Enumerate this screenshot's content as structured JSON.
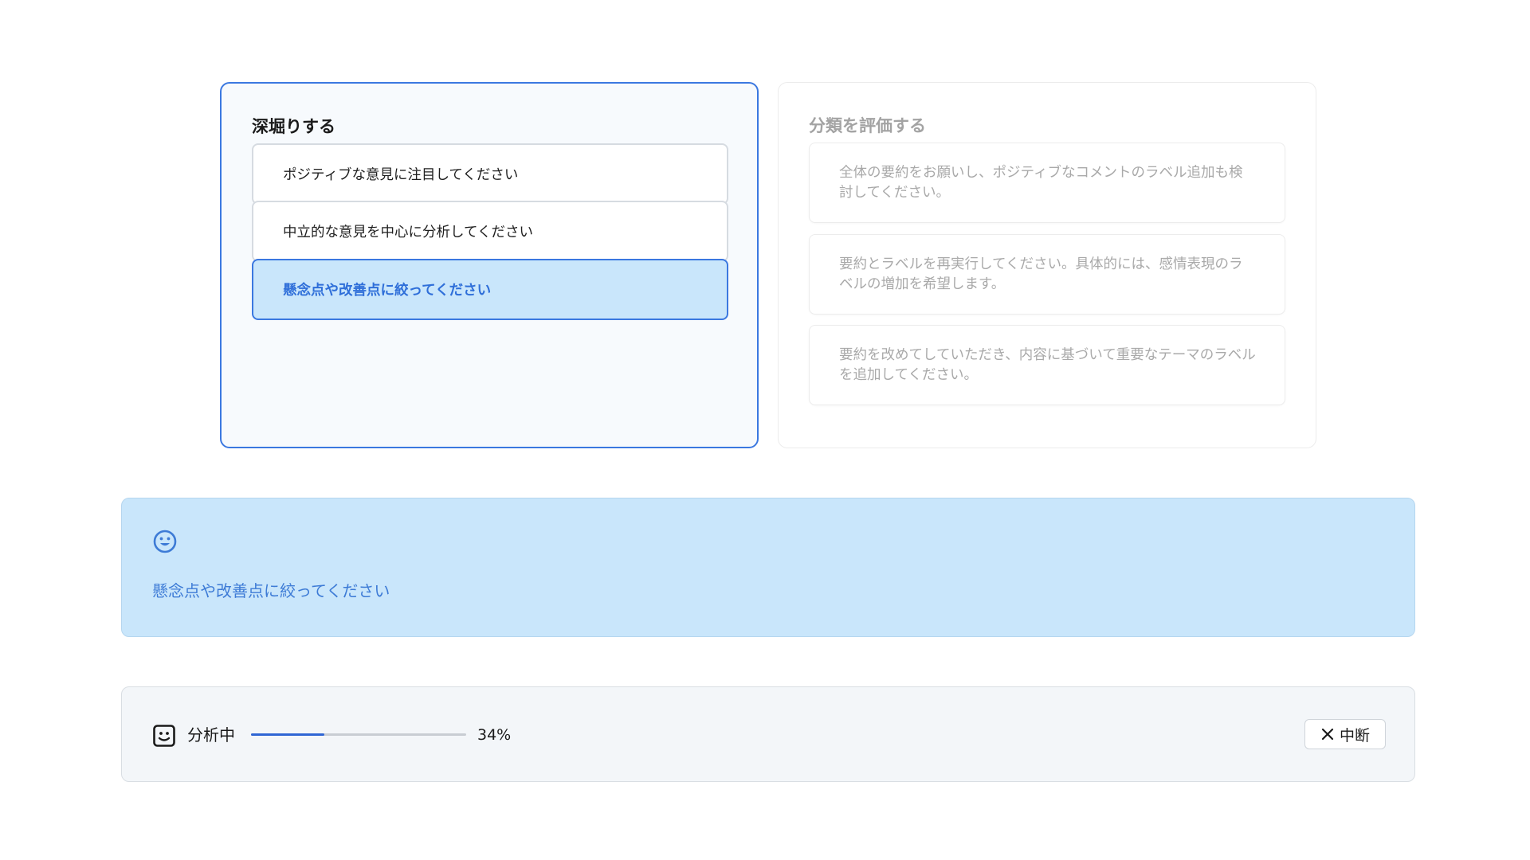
{
  "deep_dive": {
    "title": "深堀りする",
    "options": [
      {
        "label": "ポジティブな意見に注目してください"
      },
      {
        "label": "中立的な意見を中心に分析してください"
      },
      {
        "label": "懸念点や改善点に絞ってください"
      }
    ],
    "selected_index": 2
  },
  "evaluate": {
    "title": "分類を評価する",
    "options": [
      {
        "label": "全体の要約をお願いし、ポジティブなコメントのラベル追加も検討してください。"
      },
      {
        "label": "要約とラベルを再実行してください。具体的には、感情表現のラベルの増加を希望します。"
      },
      {
        "label": "要約を改めてしていただき、内容に基づいて重要なテーマのラベルを追加してください。"
      }
    ]
  },
  "result": {
    "icon": "smiley-icon",
    "text": "懸念点や改善点に絞ってください"
  },
  "progress": {
    "icon": "robot-face-icon",
    "label": "分析中",
    "percent": 34,
    "percent_text": "34%",
    "stop_label": "中断",
    "stop_icon": "close-icon"
  },
  "colors": {
    "accent": "#3b78e0",
    "selected_bg": "#c9e6fb",
    "muted_text": "#a9a9a9"
  }
}
